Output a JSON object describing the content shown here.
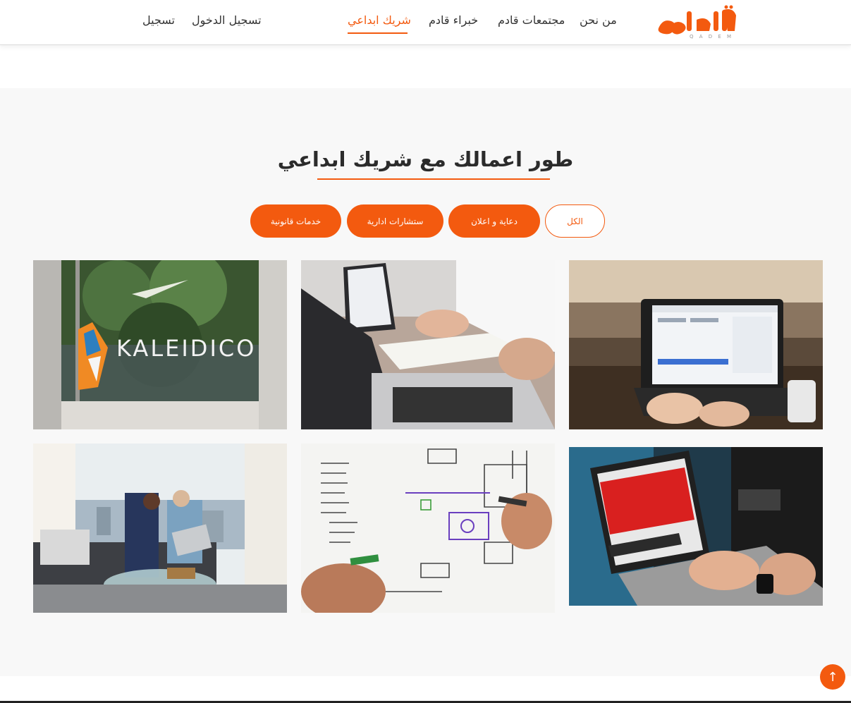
{
  "brand": {
    "logo_text": "قادم",
    "logo_sub": "Q A D E M"
  },
  "nav": {
    "links": [
      {
        "label": "من نحن"
      },
      {
        "label": "مجتمعات قادم"
      },
      {
        "label": "خبراء قادم"
      },
      {
        "label": "شريك ابداعي"
      }
    ],
    "login_label": "تسجيل الدخول",
    "register_label": "تسجيل"
  },
  "section": {
    "title": "طور اعمالك مع شريك ابداعي",
    "filters": [
      {
        "label": "الكل"
      },
      {
        "label": "دعاية و اعلان"
      },
      {
        "label": "ستشارات ادارية"
      },
      {
        "label": "خدمات قانونية"
      }
    ]
  },
  "cards": [
    {
      "image": "laptop-dashboard-photo"
    },
    {
      "image": "meeting-laptops-notes-photo"
    },
    {
      "image": "kaleidico-window-sign-photo",
      "sign_text": "KALEIDICO"
    },
    {
      "image": "laptop-red-website-photo"
    },
    {
      "image": "whiteboard-sketch-photo"
    },
    {
      "image": "office-sofa-meeting-photo"
    }
  ],
  "scroll_top": {
    "icon": "arrow-up-icon",
    "glyph": "↑"
  },
  "colors": {
    "accent": "#f35a0f",
    "section_bg": "#f8f8f8",
    "text": "#333333"
  }
}
